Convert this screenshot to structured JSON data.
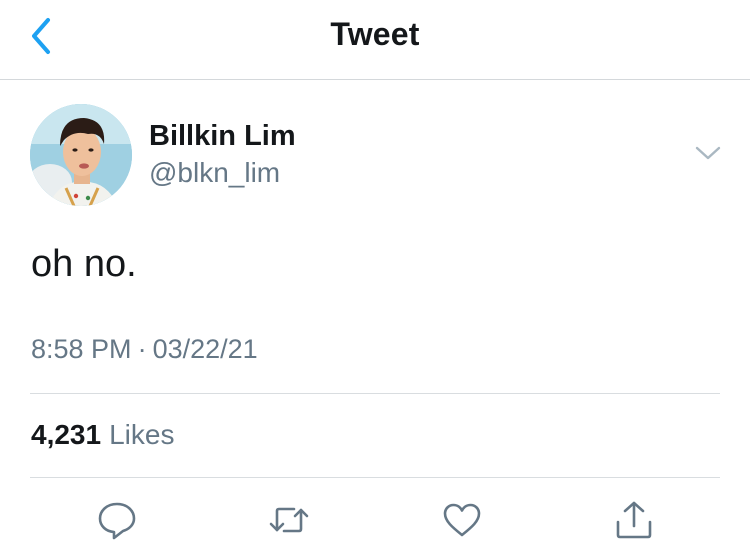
{
  "header": {
    "title": "Tweet",
    "back_icon": "chevron-left-icon"
  },
  "tweet": {
    "author_name": "Billkin Lim",
    "author_handle": "@blkn_lim",
    "text": "oh no.",
    "time": "8:58 PM",
    "separator": "·",
    "date": "03/22/21",
    "likes_count": "4,231",
    "likes_label": "Likes"
  },
  "actions": [
    "reply-icon",
    "retweet-icon",
    "like-icon",
    "share-icon"
  ],
  "colors": {
    "accent": "#1da1f2",
    "primary_text": "#14171a",
    "secondary_text": "#657786",
    "divider": "#d9dde0"
  }
}
